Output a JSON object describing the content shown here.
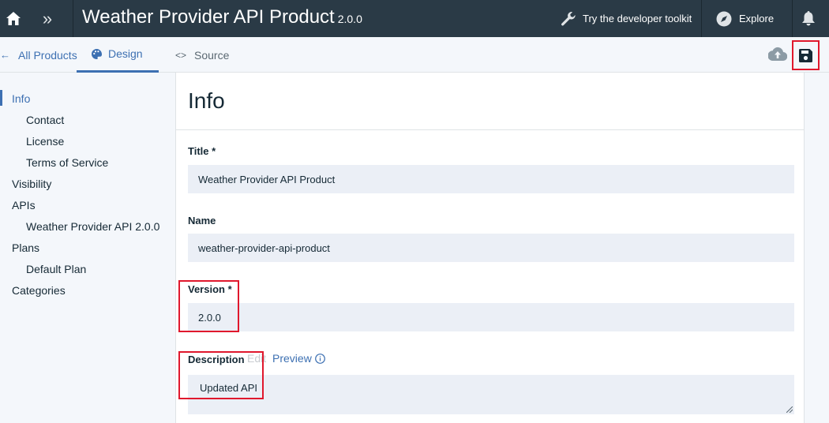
{
  "header": {
    "title": "Weather Provider API Product",
    "version": "2.0.0",
    "toolkit_label": "Try the developer toolkit",
    "explore_label": "Explore"
  },
  "subnav": {
    "back_label": "All Products",
    "tabs": [
      {
        "label": "Design",
        "active": true
      },
      {
        "label": "Source",
        "active": false
      }
    ]
  },
  "sidebar": {
    "items": [
      {
        "label": "Info",
        "level": 0,
        "active": true
      },
      {
        "label": "Contact",
        "level": 1
      },
      {
        "label": "License",
        "level": 1
      },
      {
        "label": "Terms of Service",
        "level": 1
      },
      {
        "label": "Visibility",
        "level": 0
      },
      {
        "label": "APIs",
        "level": 0
      },
      {
        "label": "Weather Provider API 2.0.0",
        "level": 1
      },
      {
        "label": "Plans",
        "level": 0
      },
      {
        "label": "Default Plan",
        "level": 1
      },
      {
        "label": "Categories",
        "level": 0
      }
    ]
  },
  "main": {
    "heading": "Info",
    "fields": {
      "title": {
        "label": "Title",
        "required": "*",
        "value": "Weather Provider API Product"
      },
      "name": {
        "label": "Name",
        "value": "weather-provider-api-product"
      },
      "version": {
        "label": "Version",
        "required": "*",
        "value": "2.0.0"
      },
      "description": {
        "label": "Description",
        "edit_label": "Edit",
        "preview_label": "Preview",
        "value": "Updated API"
      }
    }
  },
  "colors": {
    "header_bg": "#2a3a46",
    "accent": "#3d70b2",
    "highlight": "#e0182d",
    "input_bg": "#ebeff6"
  }
}
